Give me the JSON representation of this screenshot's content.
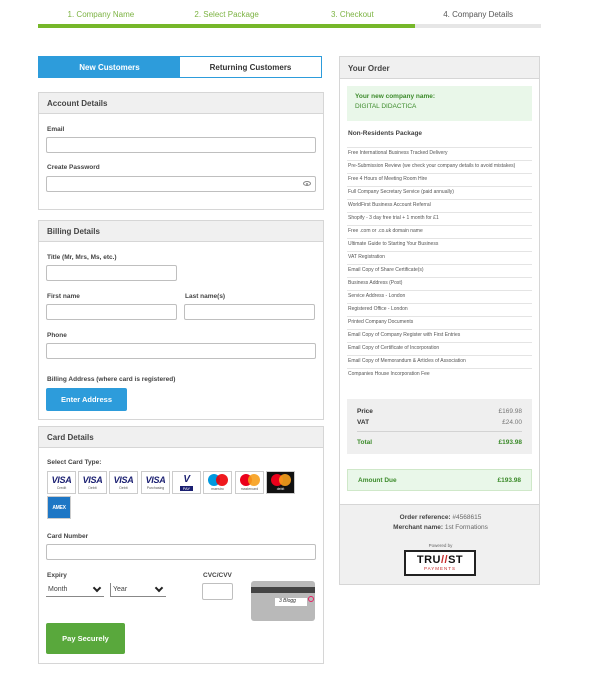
{
  "steps": [
    {
      "label": "1. Company Name"
    },
    {
      "label": "2. Select Package"
    },
    {
      "label": "3. Checkout"
    },
    {
      "label": "4. Company Details"
    }
  ],
  "tabs": {
    "new": "New Customers",
    "returning": "Returning Customers"
  },
  "account": {
    "title": "Account Details",
    "email_label": "Email",
    "password_label": "Create Password"
  },
  "billing": {
    "title": "Billing Details",
    "title_label": "Title (Mr, Mrs, Ms, etc.)",
    "first_name_label": "First name",
    "last_name_label": "Last name(s)",
    "phone_label": "Phone",
    "address_label": "Billing Address (where card is registered)",
    "enter_address_button": "Enter Address"
  },
  "card": {
    "title": "Card Details",
    "select_type_label": "Select Card Type:",
    "types": [
      {
        "brand": "VISA",
        "sub": "Credit"
      },
      {
        "brand": "VISA",
        "sub": "Debit"
      },
      {
        "brand": "VISA",
        "sub": "Debit"
      },
      {
        "brand": "VISA",
        "sub": "Purchasing"
      },
      {
        "brand": "V",
        "sub": "PAY"
      },
      {
        "brand": "maestro",
        "sub": "maestro"
      },
      {
        "brand": "mastercard",
        "sub": "mastercard"
      },
      {
        "brand": "mastercard",
        "sub": "debit"
      },
      {
        "brand": "AMEX",
        "sub": ""
      }
    ],
    "number_label": "Card Number",
    "expiry_label": "Expiry",
    "month_value": "Month",
    "year_value": "Year",
    "cvc_label": "CVC/CVV",
    "pay_button": "Pay Securely"
  },
  "order": {
    "title": "Your Order",
    "company_label": "Your new company name:",
    "company_name": "DIGITAL DIDACTICA",
    "package_title": "Non-Residents Package",
    "items": [
      "Free International Business Tracked Delivery",
      "Pre-Submission Review (we check your company details to avoid mistakes)",
      "Free 4 Hours of Meeting Room Hire",
      "Full Company Secretary Service (paid annually)",
      "WorldFirst Business Account Referral",
      "Shopify - 3 day free trial + 1 month for £1",
      "Free .com or .co.uk domain name",
      "Ultimate Guide to Starting Your Business",
      "VAT Registration",
      "Email Copy of Share Certificate(s)",
      "Business Address (Post)",
      "Service Address - London",
      "Registered Office - London",
      "Printed Company Documents",
      "Email Copy of Company Register with First Entries",
      "Email Copy of Certificate of Incorporation",
      "Email Copy of Memorandum & Articles of Association",
      "Companies House Incorporation Fee"
    ],
    "price_label": "Price",
    "price_value": "£169.98",
    "vat_label": "VAT",
    "vat_value": "£24.00",
    "total_label": "Total",
    "total_value": "£193.98",
    "due_label": "Amount Due",
    "due_value": "£193.98",
    "ref_label": "Order reference:",
    "ref_value": "#4568615",
    "merchant_label": "Merchant name:",
    "merchant_value": "1st Formations",
    "powered_by": "Powered by",
    "trust_word_left": "TRU",
    "trust_word_right": "ST",
    "trust_payments": "PAYMENTS"
  }
}
